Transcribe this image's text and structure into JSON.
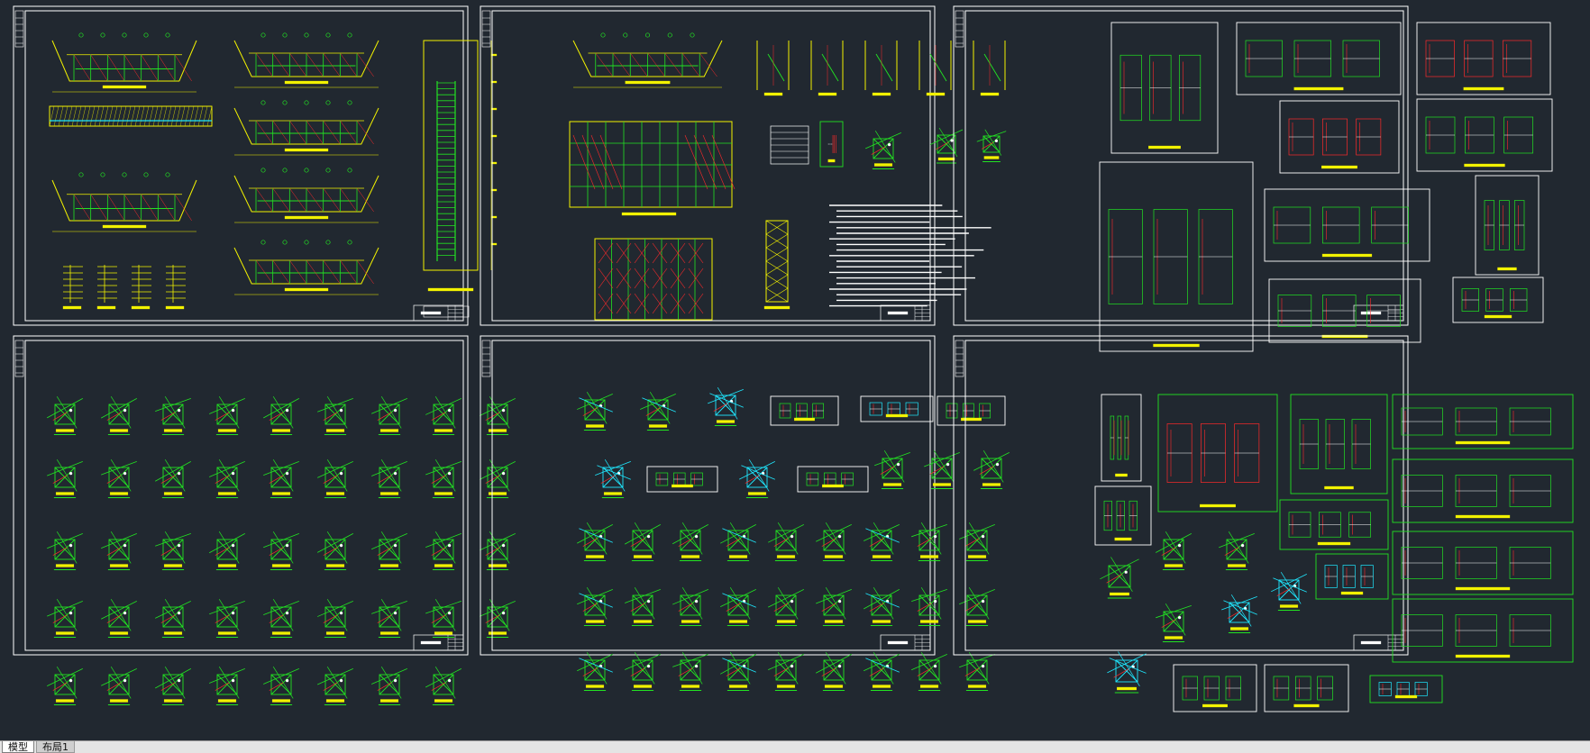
{
  "colors": {
    "background": "#212830",
    "frame": "#ffffff",
    "green": "#22e322",
    "yellow": "#f2f200",
    "red": "#ff2a2a",
    "cyan": "#1fe8ff"
  },
  "tabs": [
    {
      "label": "模型",
      "active": true
    },
    {
      "label": "布局1",
      "active": false
    }
  ],
  "sheets": [
    {
      "id": "sheet-1",
      "style": "plans",
      "palette": "yellow"
    },
    {
      "id": "sheet-2",
      "style": "elevations-notes",
      "palette": "yellow"
    },
    {
      "id": "sheet-3",
      "style": "framed-details",
      "palette": "white"
    },
    {
      "id": "sheet-4",
      "style": "node-grid",
      "palette": "green"
    },
    {
      "id": "sheet-5",
      "style": "node-grid-boxed",
      "palette": "green"
    },
    {
      "id": "sheet-6",
      "style": "green-frames",
      "palette": "green"
    }
  ]
}
